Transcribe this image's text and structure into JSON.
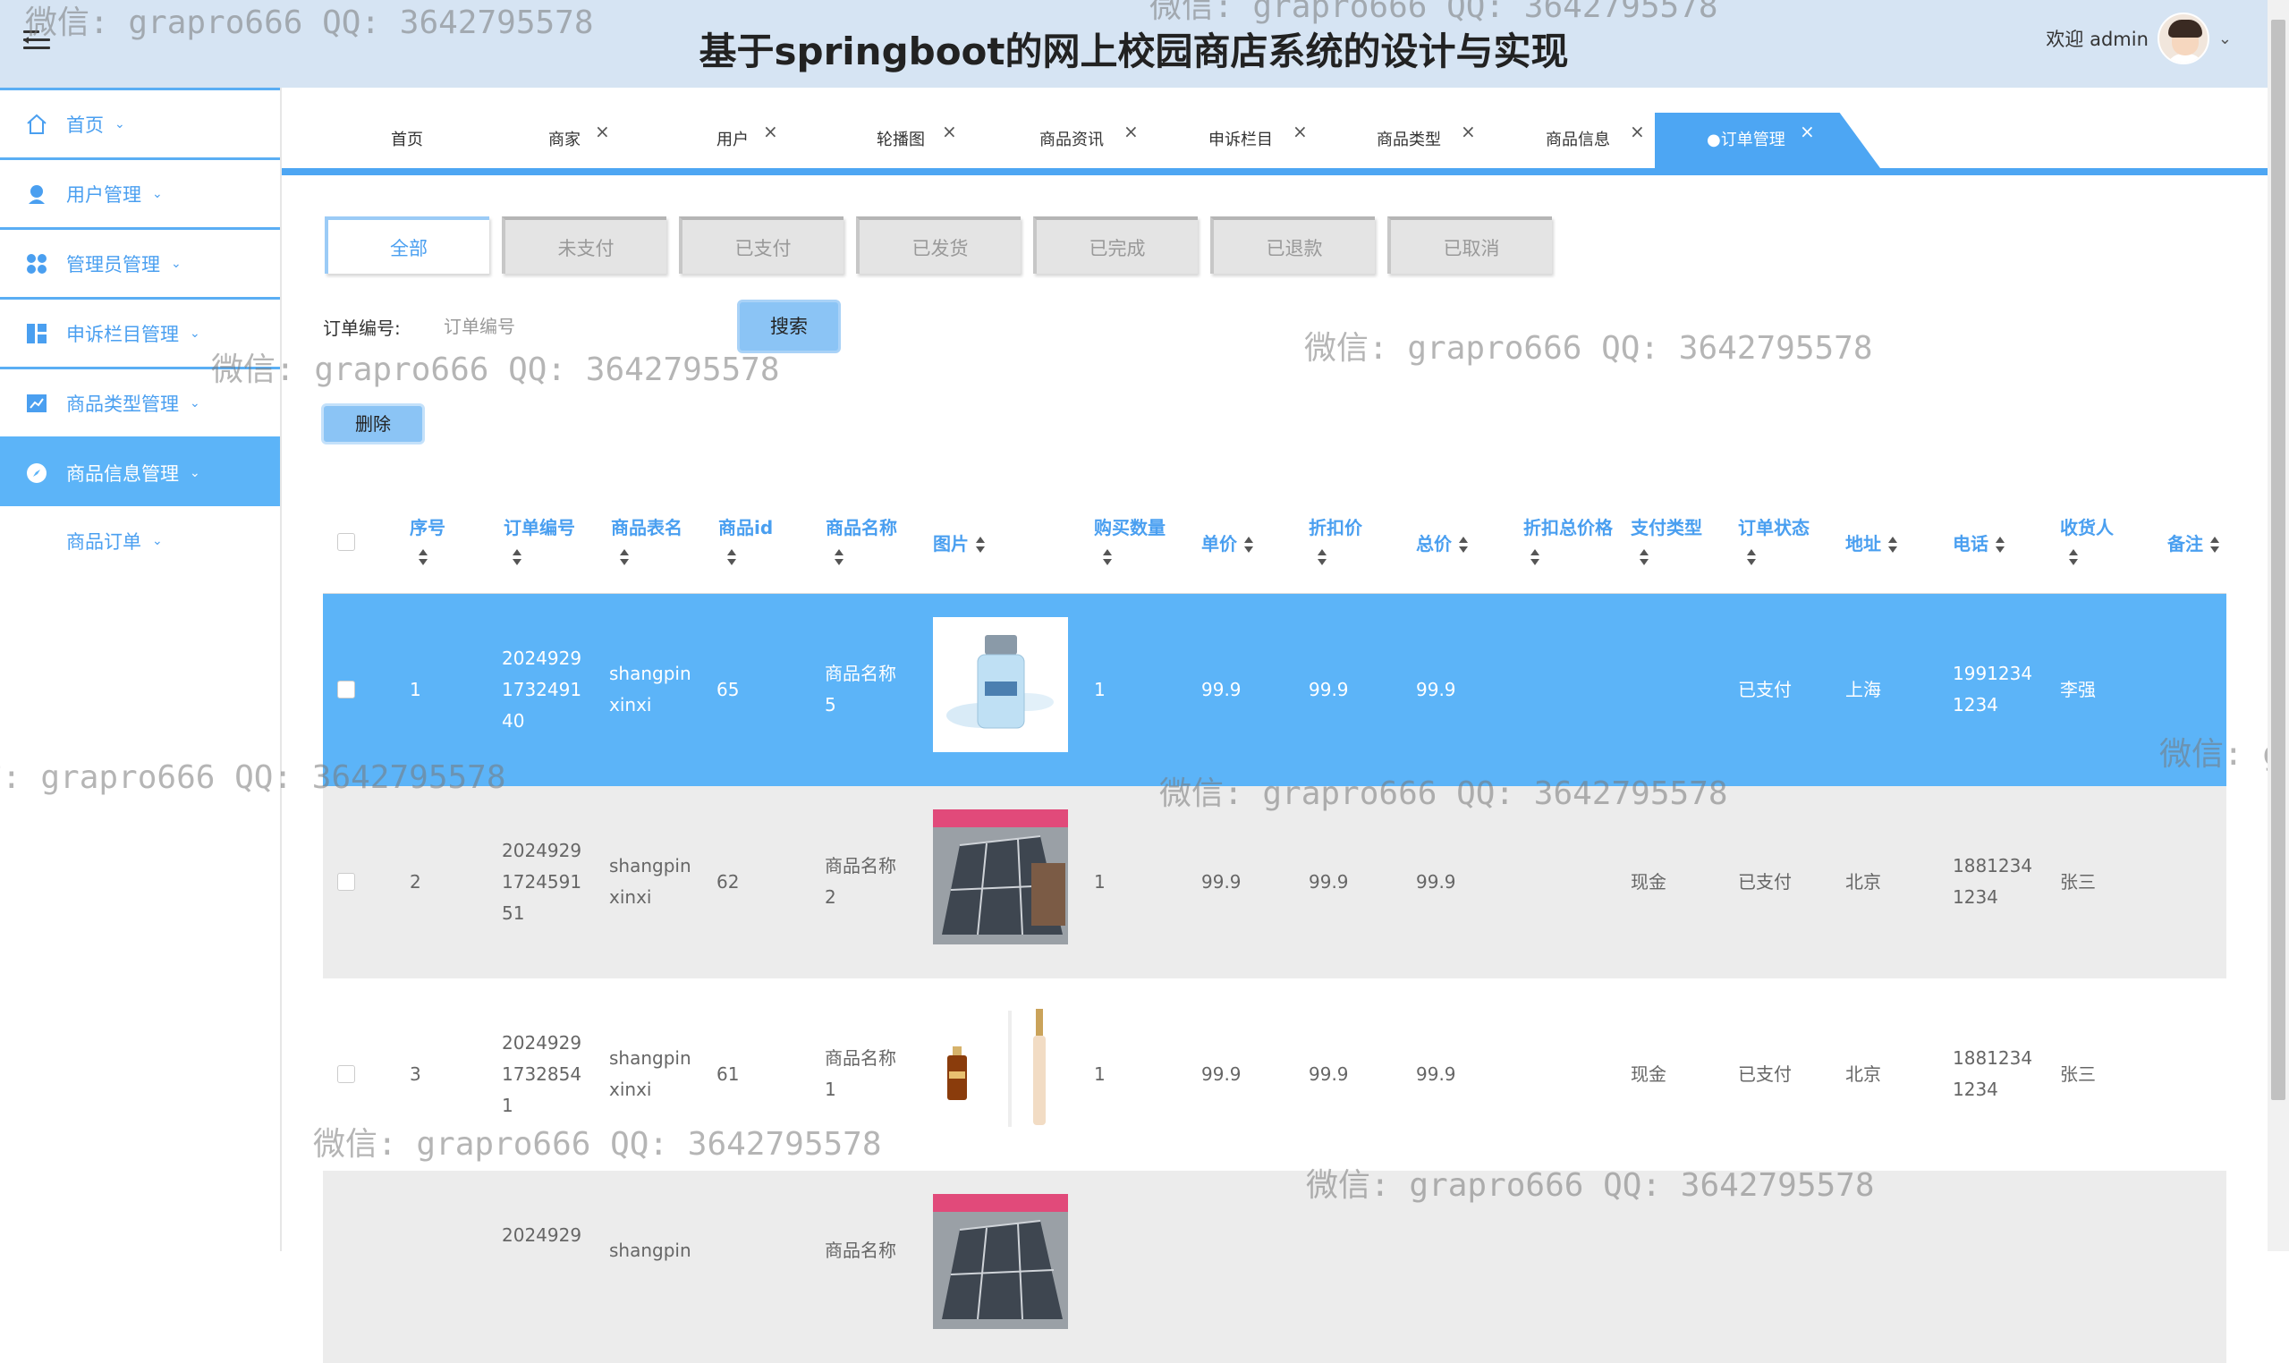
{
  "header": {
    "title": "基于springboot的网上校园商店系统的设计与实现",
    "welcome": "欢迎 admin"
  },
  "sidebar": {
    "items": [
      {
        "label": "首页",
        "icon": "home-icon"
      },
      {
        "label": "用户管理",
        "icon": "user-icon"
      },
      {
        "label": "管理员管理",
        "icon": "grid-icon"
      },
      {
        "label": "申诉栏目管理",
        "icon": "panel-icon"
      },
      {
        "label": "商品类型管理",
        "icon": "chart-icon"
      },
      {
        "label": "商品信息管理",
        "icon": "compass-icon"
      },
      {
        "label": "商品订单",
        "icon": ""
      }
    ]
  },
  "tabs": [
    "首页",
    "商家",
    "用户",
    "轮播图",
    "商品资讯",
    "申诉栏目",
    "商品类型",
    "商品信息",
    "●订单管理"
  ],
  "status_tabs": [
    "全部",
    "未支付",
    "已支付",
    "已发货",
    "已完成",
    "已退款",
    "已取消"
  ],
  "search": {
    "label": "订单编号:",
    "placeholder": "订单编号",
    "button": "搜索"
  },
  "delete_button": "删除",
  "table": {
    "headers": [
      "序号",
      "订单编号",
      "商品表名",
      "商品id",
      "商品名称",
      "图片",
      "购买数量",
      "单价",
      "折扣价",
      "总价",
      "折扣总价格",
      "支付类型",
      "订单状态",
      "地址",
      "电话",
      "收货人",
      "备注"
    ],
    "rows": [
      {
        "index": "1",
        "order_no": [
          "2024929",
          "1732491",
          "40"
        ],
        "table_name": [
          "shangpin",
          "xinxi"
        ],
        "product_id": "65",
        "product_name": [
          "商品名称",
          "5"
        ],
        "qty": "1",
        "price": "99.9",
        "discount": "99.9",
        "total": "99.9",
        "discount_total": "",
        "pay_type": "",
        "status": "已支付",
        "address": "上海",
        "phone": [
          "1991234",
          "1234"
        ],
        "receiver": "李强",
        "remark": "",
        "image": "bottle-image"
      },
      {
        "index": "2",
        "order_no": [
          "2024929",
          "1724591",
          "51"
        ],
        "table_name": [
          "shangpin",
          "xinxi"
        ],
        "product_id": "62",
        "product_name": [
          "商品名称",
          "2"
        ],
        "qty": "1",
        "price": "99.9",
        "discount": "99.9",
        "total": "99.9",
        "discount_total": "",
        "pay_type": "现金",
        "status": "已支付",
        "address": "北京",
        "phone": [
          "1881234",
          "1234"
        ],
        "receiver": "张三",
        "remark": "",
        "image": "pillow-image"
      },
      {
        "index": "3",
        "order_no": [
          "2024929",
          "1732854",
          "1"
        ],
        "table_name": [
          "shangpin",
          "xinxi"
        ],
        "product_id": "61",
        "product_name": [
          "商品名称",
          "1"
        ],
        "qty": "1",
        "price": "99.9",
        "discount": "99.9",
        "total": "99.9",
        "discount_total": "",
        "pay_type": "现金",
        "status": "已支付",
        "address": "北京",
        "phone": [
          "1881234",
          "1234"
        ],
        "receiver": "张三",
        "remark": "",
        "image": "serum-image"
      },
      {
        "index": "",
        "order_no": [
          "2024929",
          "",
          ""
        ],
        "table_name": [
          "shangpin",
          ""
        ],
        "product_id": "",
        "product_name": [
          "商品名称",
          ""
        ],
        "qty": "",
        "price": "",
        "discount": "",
        "total": "",
        "discount_total": "",
        "pay_type": "",
        "status": "",
        "address": "",
        "phone": [
          "",
          ""
        ],
        "receiver": "",
        "remark": "",
        "image": "pillow-image"
      }
    ]
  },
  "watermark": "微信: grapro666 QQ: 3642795578",
  "colors": {
    "accent": "#4da6f3",
    "header_bg": "#d6e4f3",
    "selected_row": "#5cb4f8"
  }
}
